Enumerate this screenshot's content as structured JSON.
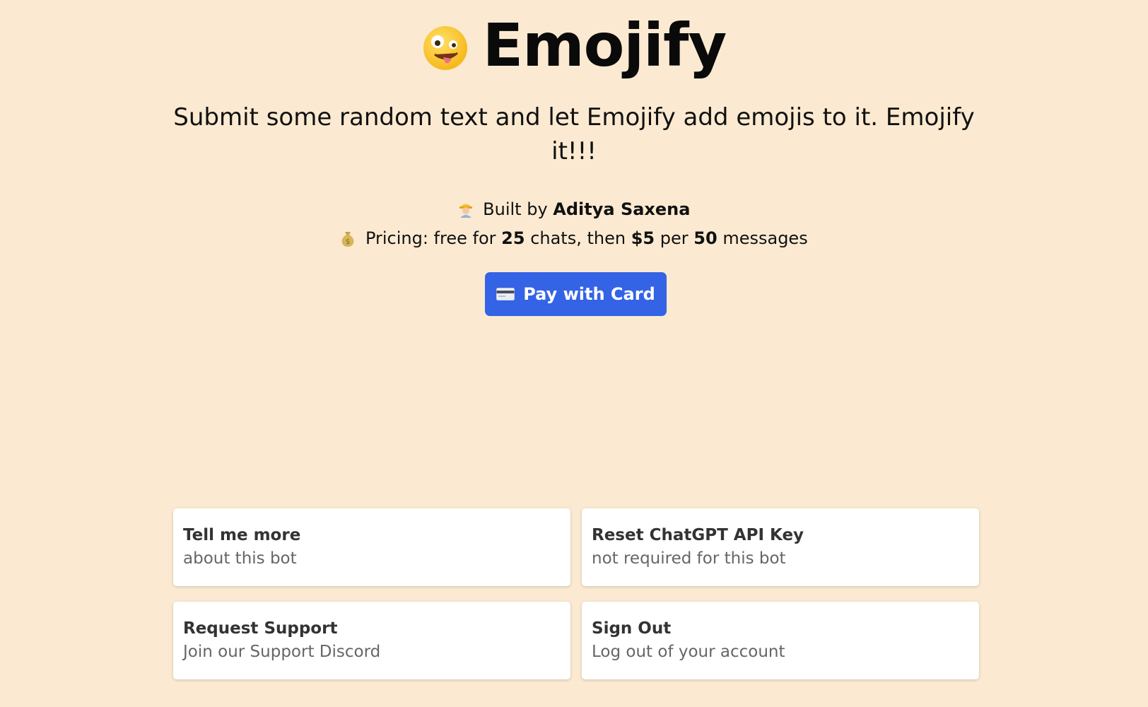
{
  "header": {
    "title": "Emojify",
    "title_icon": "zany-face-icon",
    "subtitle": "Submit some random text and let Emojify add emojis to it. Emojify it!!!"
  },
  "builder": {
    "icon": "construction-worker-icon",
    "prefix": "Built by",
    "name": "Aditya Saxena"
  },
  "pricing": {
    "icon": "money-bag-icon",
    "label": "Pricing: free for",
    "free_count": "25",
    "mid1": "chats, then",
    "price": "$5",
    "mid2": "per",
    "message_count": "50",
    "suffix": "messages"
  },
  "pay_button": {
    "icon": "credit-card-icon",
    "label": "Pay with Card",
    "color": "#3463e6"
  },
  "cards": [
    {
      "title": "Tell me more",
      "subtitle": "about this bot"
    },
    {
      "title": "Reset ChatGPT API Key",
      "subtitle": "not required for this bot"
    },
    {
      "title": "Request Support",
      "subtitle": "Join our Support Discord"
    },
    {
      "title": "Sign Out",
      "subtitle": "Log out of your account"
    }
  ],
  "colors": {
    "background": "#fbead1",
    "card_background": "#ffffff",
    "accent": "#3463e6"
  }
}
